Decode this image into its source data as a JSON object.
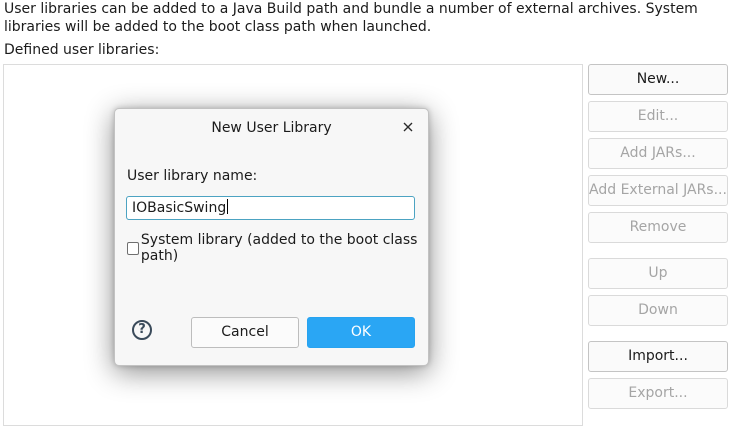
{
  "description": "User libraries can be added to a Java Build path and bundle a number of external archives. System libraries will be added to the boot class path when launched.",
  "defined_label": "Defined user libraries:",
  "side_buttons": {
    "new": "New...",
    "edit": "Edit...",
    "add_jars": "Add JARs...",
    "add_external_jars": "Add External JARs...",
    "remove": "Remove",
    "up": "Up",
    "down": "Down",
    "import": "Import...",
    "export": "Export..."
  },
  "dialog": {
    "title": "New User Library",
    "name_label": "User library name:",
    "name_value": "IOBasicSwing",
    "system_checkbox_label": "System library (added to the boot class path)",
    "system_checked": false,
    "help_glyph": "?",
    "cancel": "Cancel",
    "ok": "OK"
  },
  "colors": {
    "ok_button": "#2aa6f4",
    "input_focus": "#4ca3c2"
  }
}
